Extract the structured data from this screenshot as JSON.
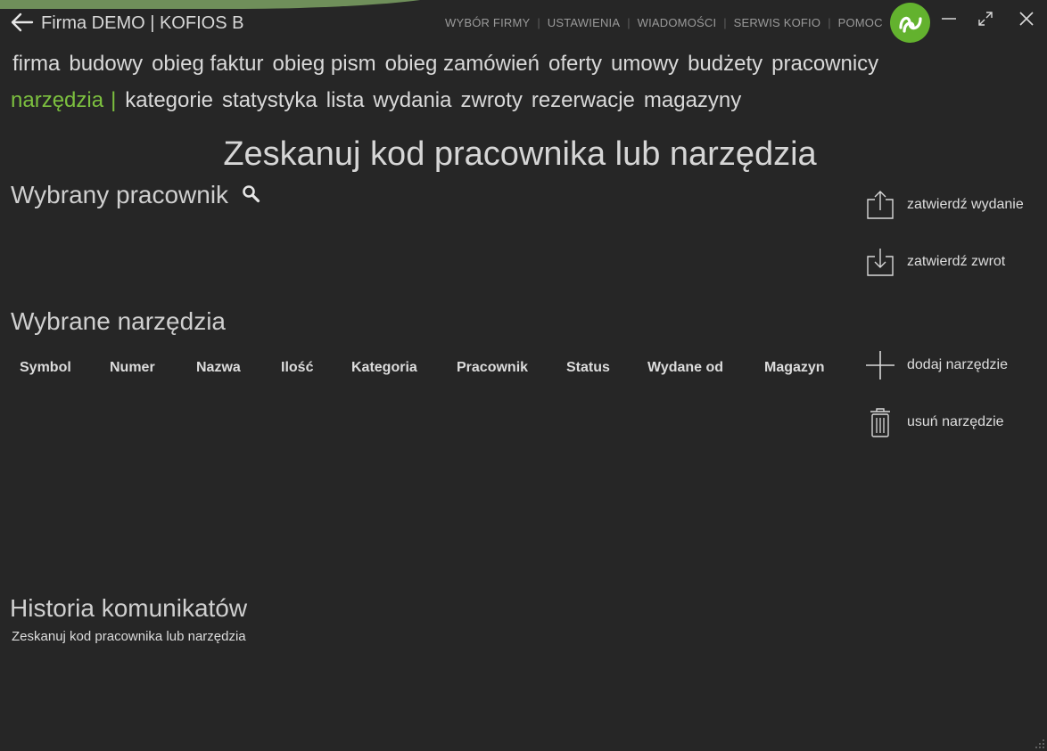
{
  "header": {
    "title": "Firma DEMO | KOFIOS B",
    "links": [
      "WYBÓR FIRMY",
      "USTAWIENIA",
      "WIADOMOŚCI",
      "SERWIS KOFIO",
      "POMOC"
    ],
    "logo_icon": "kofio-logo-icon",
    "window_controls": [
      "minimize-icon",
      "maximize-icon",
      "close-icon"
    ]
  },
  "nav": {
    "row1": [
      "firma",
      "budowy",
      "obieg faktur",
      "obieg pism",
      "obieg zamówień",
      "oferty",
      "umowy",
      "budżety",
      "pracownicy"
    ],
    "active": "narzędzia",
    "active_separator": "|",
    "row2": [
      "kategorie",
      "statystyka",
      "lista",
      "wydania",
      "zwroty",
      "rezerwacje",
      "magazyny"
    ]
  },
  "main": {
    "headline": "Zeskanuj kod pracownika lub narzędzia",
    "employee_section": "Wybrany pracownik",
    "tools_section": "Wybrane narzędzia",
    "columns": [
      "Symbol",
      "Numer",
      "Nazwa",
      "Ilość",
      "Kategoria",
      "Pracownik",
      "Status",
      "Wydane od",
      "Magazyn"
    ],
    "history_section": "Historia komunikatów",
    "history_messages": [
      "Zeskanuj kod pracownika lub narzędzia"
    ]
  },
  "actions": {
    "confirm_issue": "zatwierdź wydanie",
    "confirm_return": "zatwierdź zwrot",
    "add_tool": "dodaj narzędzie",
    "remove_tool": "usuń narzędzie"
  },
  "colors": {
    "background": "#262626",
    "accent": "#7cc03f",
    "logo": "#63b22e",
    "text": "#d4d4d4"
  }
}
